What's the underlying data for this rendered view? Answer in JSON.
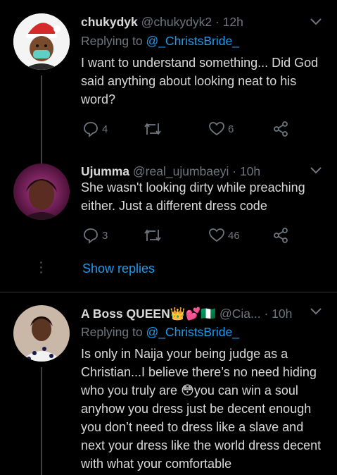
{
  "tweets": [
    {
      "name": "chukydyk",
      "handle": "@chukydyk2",
      "time": "· 12h",
      "replying_prefix": "Replying to",
      "replying_to": "@_ChristsBride_",
      "text": "I want to understand something... Did God said anything about looking neat to his word?",
      "replies": "4",
      "retweets": "",
      "likes": "6"
    },
    {
      "name": "Ujumma",
      "handle": "@real_ujumbaeyi",
      "time": "· 10h",
      "text": "She wasn't looking dirty while preaching either. Just a different dress code",
      "replies": "3",
      "retweets": "",
      "likes": "46"
    },
    {
      "name": "A Boss QUEEN👑💕🇳🇬",
      "handle": "@Cia...",
      "time": "· 10h",
      "replying_prefix": "Replying to",
      "replying_to": "@_ChristsBride_",
      "text": "Is only in Naija your being judge as a Christian...I believe there’s no need hiding who you truly are 😳you can win a soul anyhow you dress just be decent enough you don’t need to dress like a slave and next your dress like the world dress decent with what your comfortable"
    }
  ],
  "show_replies": "Show replies",
  "colors": {
    "background": "#000000",
    "link": "#1d9bf0",
    "muted": "#6e767d",
    "text": "#d9d9d9"
  }
}
